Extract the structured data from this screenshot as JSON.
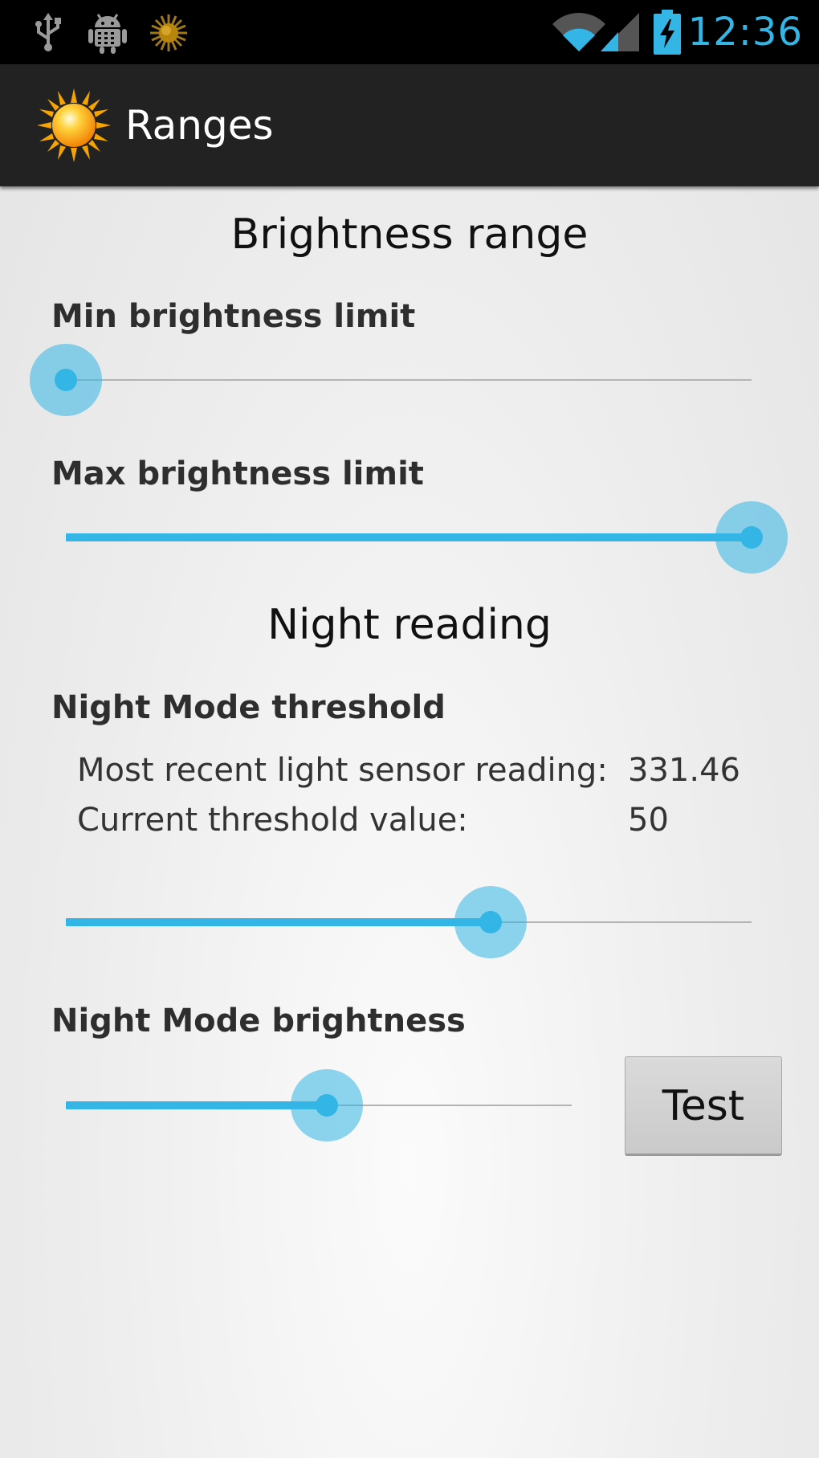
{
  "status_bar": {
    "time": "12:36",
    "icons": [
      "usb-icon",
      "android-debug-icon",
      "sun-small-icon",
      "wifi-icon",
      "signal-icon",
      "battery-charging-icon"
    ],
    "accent_color": "#33b5e5"
  },
  "action_bar": {
    "title": "Ranges",
    "logo": "sun-icon"
  },
  "brightness_section": {
    "title": "Brightness range",
    "min_limit": {
      "label": "Min brightness limit",
      "value_fraction": 0.0
    },
    "max_limit": {
      "label": "Max brightness limit",
      "value_fraction": 1.0
    }
  },
  "night_section": {
    "title": "Night reading",
    "threshold": {
      "label": "Night Mode threshold",
      "sensor_label": "Most recent light sensor reading:",
      "sensor_value": "331.46",
      "threshold_label": "Current threshold value:",
      "threshold_value": "50",
      "value_fraction": 0.62
    },
    "brightness": {
      "label": "Night Mode brightness",
      "value_fraction": 0.51,
      "test_button": "Test"
    }
  },
  "colors": {
    "accent": "#33b5e5",
    "action_bar": "#222222",
    "status_bar": "#000000"
  }
}
